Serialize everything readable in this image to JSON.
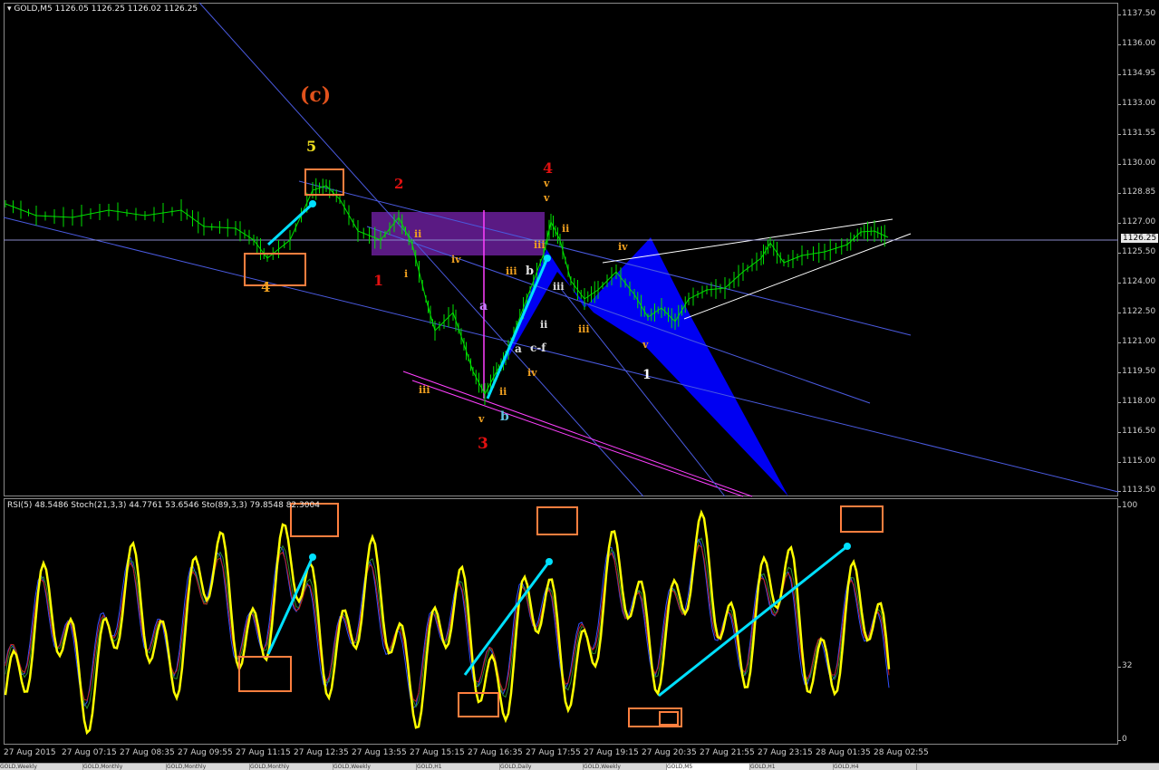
{
  "header": {
    "symbol": "GOLD,M5",
    "ohlc": "1126.05 1126.25 1126.02 1126.25",
    "indicator_header": "RSI(5) 48.5486  Stoch(21,3,3) 44.7761 53.6546  Sto(89,3,3) 79.8548 82.3004"
  },
  "price_axis": {
    "ticks": [
      "1137.50",
      "1136.00",
      "1134.95",
      "1133.00",
      "1131.55",
      "1130.00",
      "1128.85",
      "1127.00",
      "1125.50",
      "1124.00",
      "1122.50",
      "1121.00",
      "1119.50",
      "1118.00",
      "1116.50",
      "1115.00",
      "1113.50"
    ],
    "current_price": "1126.25"
  },
  "indicator_axis": {
    "ticks": [
      "100",
      "32",
      "0"
    ]
  },
  "time_axis": {
    "ticks": [
      "27 Aug 2015",
      "27 Aug 07:15",
      "27 Aug 08:35",
      "27 Aug 09:55",
      "27 Aug 11:15",
      "27 Aug 12:35",
      "27 Aug 13:55",
      "27 Aug 15:15",
      "27 Aug 16:35",
      "27 Aug 17:55",
      "27 Aug 19:15",
      "27 Aug 20:35",
      "27 Aug 21:55",
      "27 Aug 23:15",
      "28 Aug 01:35",
      "28 Aug 02:55"
    ]
  },
  "wave_labels": [
    {
      "text": "(c)",
      "color": "#e0521c"
    },
    {
      "text": "5",
      "color": "#f0e020"
    },
    {
      "text": "4",
      "color": "#f0a020"
    },
    {
      "text": "2",
      "color": "#e01010"
    },
    {
      "text": "1",
      "color": "#e01010"
    },
    {
      "text": "3",
      "color": "#e01010"
    },
    {
      "text": "4",
      "color": "#e01010"
    },
    {
      "text": "v",
      "color": "#f0a020"
    },
    {
      "text": "v",
      "color": "#f0a020"
    },
    {
      "text": "ii",
      "color": "#f0a020"
    },
    {
      "text": "i",
      "color": "#f0a020"
    },
    {
      "text": "iv",
      "color": "#f0a020"
    },
    {
      "text": "iii",
      "color": "#f0a020"
    },
    {
      "text": "iii",
      "color": "#f0a020"
    },
    {
      "text": "ii",
      "color": "#f0a020"
    },
    {
      "text": "v",
      "color": "#f0a020"
    },
    {
      "text": "iii",
      "color": "#f0a020"
    },
    {
      "text": "ii",
      "color": "#f0a020"
    },
    {
      "text": "iv",
      "color": "#f0a020"
    },
    {
      "text": "iv",
      "color": "#f0a020"
    },
    {
      "text": "iii",
      "color": "#f0a020"
    },
    {
      "text": "v",
      "color": "#f0a020"
    },
    {
      "text": "a",
      "color": "#c080ff"
    },
    {
      "text": "b",
      "color": "#60c0e0"
    },
    {
      "text": "a",
      "color": "#e0e0e0"
    },
    {
      "text": "b",
      "color": "#e0e0e0"
    },
    {
      "text": "c-f",
      "color": "#e0e0e0"
    },
    {
      "text": "ii",
      "color": "#e0e0e0"
    },
    {
      "text": "iii",
      "color": "#e0e0e0"
    },
    {
      "text": "1",
      "color": "#ffffff"
    }
  ],
  "tabs": [
    {
      "label": "GOLD,Weekly"
    },
    {
      "label": "GOLD,Monthly"
    },
    {
      "label": "GOLD,Monthly"
    },
    {
      "label": "GOLD,Monthly"
    },
    {
      "label": "GOLD,Weekly"
    },
    {
      "label": "GOLD,H1"
    },
    {
      "label": "GOLD,Daily"
    },
    {
      "label": "GOLD,Weekly"
    },
    {
      "label": "GOLD,M5"
    },
    {
      "label": "GOLD,H1"
    },
    {
      "label": "GOLD,H4"
    }
  ],
  "colors": {
    "candle_up": "#00e000",
    "rsi": "#ffff00",
    "arrow": "#00e0ff",
    "box": "#ff7f3f",
    "pattern": "#0000ff",
    "zone": "#6a1f9a"
  }
}
